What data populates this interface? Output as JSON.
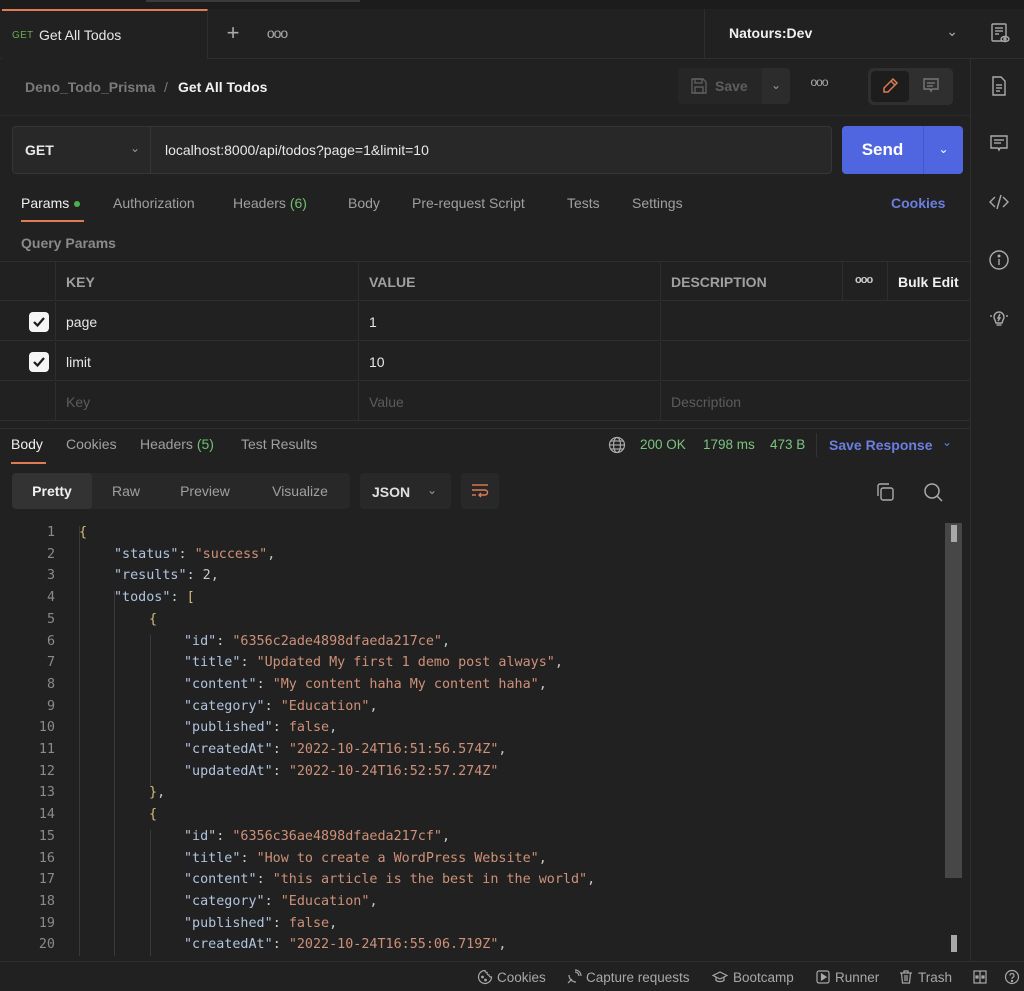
{
  "app": {
    "active_tab": {
      "method": "GET",
      "label": "Get All Todos"
    },
    "new_tab_icon": "plus-icon",
    "tab_menu_icon": "more-horizontal-icon",
    "environment": "Natours:Dev"
  },
  "breadcrumb": {
    "parent": "Deno_Todo_Prisma",
    "separator": "/",
    "current": "Get All Todos"
  },
  "toolbar": {
    "save_label": "Save"
  },
  "request": {
    "method": "GET",
    "url": "localhost:8000/api/todos?page=1&limit=10",
    "send_label": "Send",
    "tabs": [
      {
        "label": "Params",
        "active": true
      },
      {
        "label": "Authorization"
      },
      {
        "label": "Headers",
        "count": "(6)"
      },
      {
        "label": "Body"
      },
      {
        "label": "Pre-request Script"
      },
      {
        "label": "Tests"
      },
      {
        "label": "Settings"
      }
    ],
    "cookies_link": "Cookies"
  },
  "params": {
    "section_label": "Query Params",
    "columns": [
      "KEY",
      "VALUE",
      "DESCRIPTION"
    ],
    "bulk_edit_label": "Bulk Edit",
    "rows": [
      {
        "checked": true,
        "key": "page",
        "value": "1",
        "description": ""
      },
      {
        "checked": true,
        "key": "limit",
        "value": "10",
        "description": ""
      }
    ],
    "placeholders": {
      "key": "Key",
      "value": "Value",
      "description": "Description"
    }
  },
  "response": {
    "tabs": [
      {
        "label": "Body",
        "active": true
      },
      {
        "label": "Cookies"
      },
      {
        "label": "Headers",
        "count": "(5)"
      },
      {
        "label": "Test Results"
      }
    ],
    "status": "200 OK",
    "time": "1798 ms",
    "size": "473 B",
    "save_response_label": "Save Response",
    "view_modes": [
      "Pretty",
      "Raw",
      "Preview",
      "Visualize"
    ],
    "active_view": "Pretty",
    "format": "JSON",
    "code_lines": [
      {
        "n": "1",
        "indent": 0,
        "parts": [
          [
            "b",
            "{"
          ]
        ]
      },
      {
        "n": "2",
        "indent": 1,
        "parts": [
          [
            "k",
            "\"status\""
          ],
          [
            "n",
            ": "
          ],
          [
            "s",
            "\"success\""
          ],
          [
            "n",
            ","
          ]
        ]
      },
      {
        "n": "3",
        "indent": 1,
        "parts": [
          [
            "k",
            "\"results\""
          ],
          [
            "n",
            ": 2,"
          ]
        ]
      },
      {
        "n": "4",
        "indent": 1,
        "parts": [
          [
            "k",
            "\"todos\""
          ],
          [
            "n",
            ": "
          ],
          [
            "b",
            "["
          ]
        ]
      },
      {
        "n": "5",
        "indent": 2,
        "parts": [
          [
            "b",
            "{"
          ]
        ]
      },
      {
        "n": "6",
        "indent": 3,
        "parts": [
          [
            "k",
            "\"id\""
          ],
          [
            "n",
            ": "
          ],
          [
            "s",
            "\"6356c2ade4898dfaeda217ce\""
          ],
          [
            "n",
            ","
          ]
        ]
      },
      {
        "n": "7",
        "indent": 3,
        "parts": [
          [
            "k",
            "\"title\""
          ],
          [
            "n",
            ": "
          ],
          [
            "s",
            "\"Updated My first 1 demo post always\""
          ],
          [
            "n",
            ","
          ]
        ]
      },
      {
        "n": "8",
        "indent": 3,
        "parts": [
          [
            "k",
            "\"content\""
          ],
          [
            "n",
            ": "
          ],
          [
            "s",
            "\"My content haha My content haha\""
          ],
          [
            "n",
            ","
          ]
        ]
      },
      {
        "n": "9",
        "indent": 3,
        "parts": [
          [
            "k",
            "\"category\""
          ],
          [
            "n",
            ": "
          ],
          [
            "s",
            "\"Education\""
          ],
          [
            "n",
            ","
          ]
        ]
      },
      {
        "n": "10",
        "indent": 3,
        "parts": [
          [
            "k",
            "\"published\""
          ],
          [
            "n",
            ": "
          ],
          [
            "s",
            "false"
          ],
          [
            "n",
            ","
          ]
        ]
      },
      {
        "n": "11",
        "indent": 3,
        "parts": [
          [
            "k",
            "\"createdAt\""
          ],
          [
            "n",
            ": "
          ],
          [
            "s",
            "\"2022-10-24T16:51:56.574Z\""
          ],
          [
            "n",
            ","
          ]
        ]
      },
      {
        "n": "12",
        "indent": 3,
        "parts": [
          [
            "k",
            "\"updatedAt\""
          ],
          [
            "n",
            ": "
          ],
          [
            "s",
            "\"2022-10-24T16:52:57.274Z\""
          ]
        ]
      },
      {
        "n": "13",
        "indent": 2,
        "parts": [
          [
            "b",
            "}"
          ],
          [
            "n",
            ","
          ]
        ]
      },
      {
        "n": "14",
        "indent": 2,
        "parts": [
          [
            "b",
            "{"
          ]
        ]
      },
      {
        "n": "15",
        "indent": 3,
        "parts": [
          [
            "k",
            "\"id\""
          ],
          [
            "n",
            ": "
          ],
          [
            "s",
            "\"6356c36ae4898dfaeda217cf\""
          ],
          [
            "n",
            ","
          ]
        ]
      },
      {
        "n": "16",
        "indent": 3,
        "parts": [
          [
            "k",
            "\"title\""
          ],
          [
            "n",
            ": "
          ],
          [
            "s",
            "\"How to create a WordPress Website\""
          ],
          [
            "n",
            ","
          ]
        ]
      },
      {
        "n": "17",
        "indent": 3,
        "parts": [
          [
            "k",
            "\"content\""
          ],
          [
            "n",
            ": "
          ],
          [
            "s",
            "\"this article is the best in the world\""
          ],
          [
            "n",
            ","
          ]
        ]
      },
      {
        "n": "18",
        "indent": 3,
        "parts": [
          [
            "k",
            "\"category\""
          ],
          [
            "n",
            ": "
          ],
          [
            "s",
            "\"Education\""
          ],
          [
            "n",
            ","
          ]
        ]
      },
      {
        "n": "19",
        "indent": 3,
        "parts": [
          [
            "k",
            "\"published\""
          ],
          [
            "n",
            ": "
          ],
          [
            "s",
            "false"
          ],
          [
            "n",
            ","
          ]
        ]
      },
      {
        "n": "20",
        "indent": 3,
        "parts": [
          [
            "k",
            "\"createdAt\""
          ],
          [
            "n",
            ": "
          ],
          [
            "s",
            "\"2022-10-24T16:55:06.719Z\""
          ],
          [
            "n",
            ","
          ]
        ]
      }
    ]
  },
  "statusbar": {
    "items": [
      {
        "label": "Cookies",
        "icon": "cookie-icon"
      },
      {
        "label": "Capture requests",
        "icon": "satellite-icon"
      },
      {
        "label": "Bootcamp",
        "icon": "graduation-cap-icon"
      },
      {
        "label": "Runner",
        "icon": "play-square-icon"
      },
      {
        "label": "Trash",
        "icon": "trash-icon"
      }
    ]
  },
  "colors": {
    "accent_orange": "#e07b53",
    "send_blue": "#5066e0",
    "link_blue": "#6b7fe0",
    "status_green": "#7bc47f",
    "json_string": "#ce9178",
    "json_key": "#b0c4de",
    "background": "#212121"
  }
}
